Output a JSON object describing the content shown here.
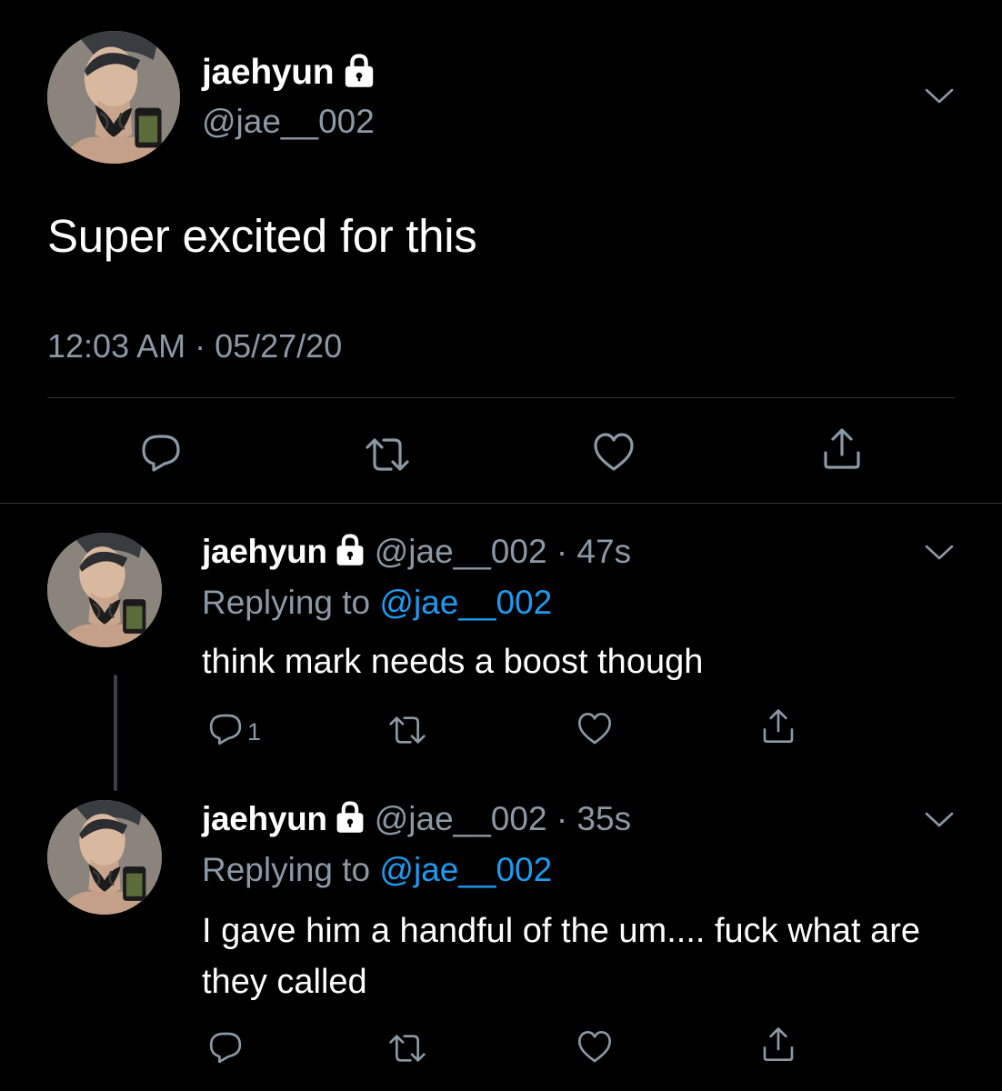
{
  "main_tweet": {
    "display_name": "jaehyun",
    "handle": "@jae__002",
    "text": "Super excited for this",
    "timestamp": "12:03 AM · 05/27/20",
    "icons": [
      "lock-icon",
      "chevron-down-icon",
      "reply-icon",
      "retweet-icon",
      "like-icon",
      "share-icon"
    ]
  },
  "replies": [
    {
      "display_name": "jaehyun",
      "handle_time": "@jae__002 · 47s",
      "replying_prefix": "Replying to",
      "replying_handle": "@jae__002",
      "text": "think mark needs a boost though",
      "reply_count": "1"
    },
    {
      "display_name": "jaehyun",
      "handle_time": "@jae__002 · 35s",
      "replying_prefix": "Replying to",
      "replying_handle": "@jae__002",
      "text": "I gave him a handful of the um.... fuck what are they called",
      "reply_count": ""
    }
  ],
  "colors": {
    "background": "#000000",
    "text": "#ffffff",
    "secondary": "#8b98a5",
    "link": "#1d9bf0",
    "divider": "#2f3336"
  }
}
